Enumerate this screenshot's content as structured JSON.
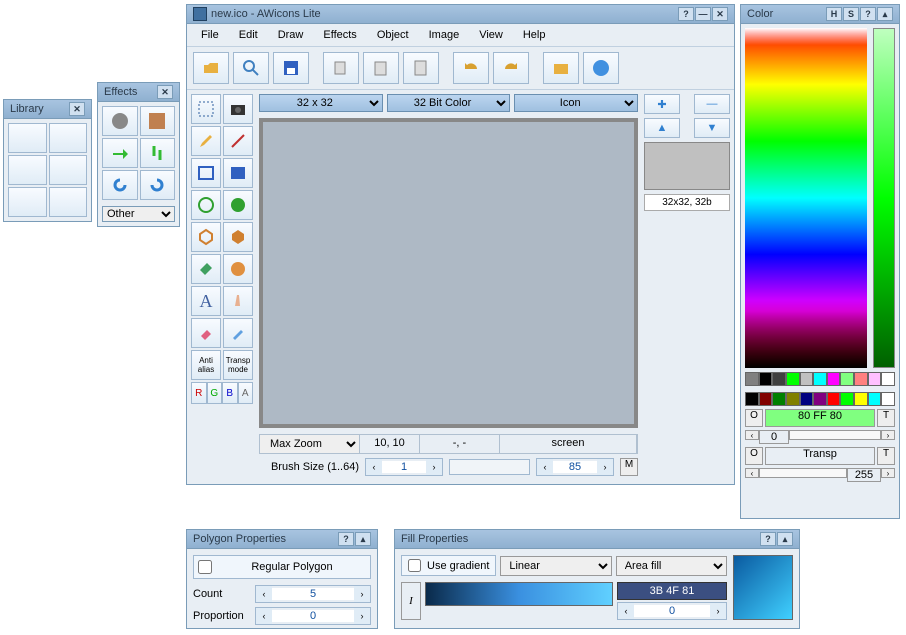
{
  "library": {
    "title": "Library"
  },
  "effects": {
    "title": "Effects",
    "dropdown": "Other"
  },
  "main": {
    "title": "new.ico - AWicons Lite",
    "menu": [
      "File",
      "Edit",
      "Draw",
      "Effects",
      "Object",
      "Image",
      "View",
      "Help"
    ],
    "size_dd": "32 x 32",
    "color_dd": "32 Bit Color",
    "type_dd": "Icon",
    "zoom_dd": "Max Zoom",
    "pos": "10, 10",
    "pick": "-, -",
    "target": "screen",
    "brush_label": "Brush Size (1..64)",
    "brush_val": "1",
    "scale_val": "85",
    "scale_m": "M",
    "preview_label": "32x32, 32b",
    "anti_alias": "Anti\nalias",
    "transp_mode": "Transp\nmode",
    "rgba": {
      "r": "R",
      "g": "G",
      "b": "B",
      "a": "A"
    }
  },
  "color": {
    "title": "Color",
    "swatches1": [
      "#808080",
      "#000000",
      "#404040",
      "#00ff00",
      "#c0c0c0",
      "#00ffff",
      "#ff00ff",
      "#80ff80",
      "#ff8080",
      "#ffc0ff",
      "#ffffff"
    ],
    "swatches2": [
      "#000000",
      "#800000",
      "#008000",
      "#808000",
      "#000080",
      "#800080",
      "#ff0000",
      "#00ff00",
      "#ffff00",
      "#00ffff",
      "#ffffff"
    ],
    "o": "O",
    "t": "T",
    "hex": "80 FF 80",
    "val1": "0",
    "transp": "Transp",
    "alpha_val": "255"
  },
  "poly": {
    "title": "Polygon Properties",
    "regular": "Regular Polygon",
    "count_label": "Count",
    "count": "5",
    "prop_label": "Proportion",
    "prop": "0"
  },
  "fill": {
    "title": "Fill Properties",
    "use_grad": "Use gradient",
    "type": "Linear",
    "area": "Area fill",
    "hex": "3B 4F 81",
    "pos": "0",
    "i": "I"
  }
}
